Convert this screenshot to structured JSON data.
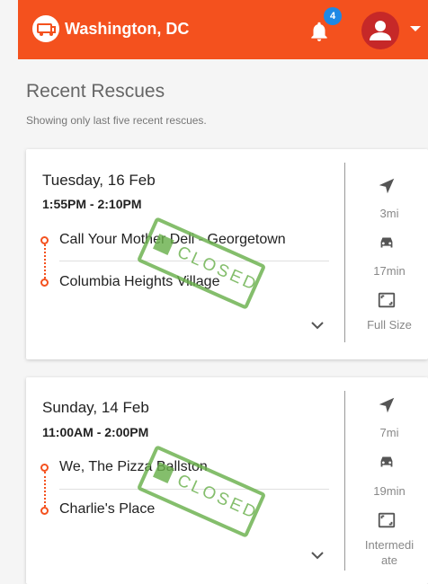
{
  "header": {
    "city": "Washington, DC",
    "notification_count": "4"
  },
  "page": {
    "title": "Recent Rescues",
    "subtitle": "Showing only last five recent rescues."
  },
  "rescues": [
    {
      "date": "Tuesday, 16 Feb",
      "time": "1:55PM - 2:10PM",
      "pickup": "Call Your Mother Deli - Georgetown",
      "dropoff": "Columbia Heights Village",
      "status": "CLOSED",
      "distance": "3mi",
      "duration": "17min",
      "vehicle_size": "Full Size"
    },
    {
      "date": "Sunday, 14 Feb",
      "time": "11:00AM - 2:00PM",
      "pickup": "We, The Pizza Ballston",
      "dropoff": "Charlie's Place",
      "status": "CLOSED",
      "distance": "7mi",
      "duration": "19min",
      "vehicle_size": "Intermediate"
    }
  ],
  "colors": {
    "brand": "#f4511e",
    "badge": "#1e88e5",
    "avatar": "#c62828",
    "stamp": "#6ab04c"
  }
}
